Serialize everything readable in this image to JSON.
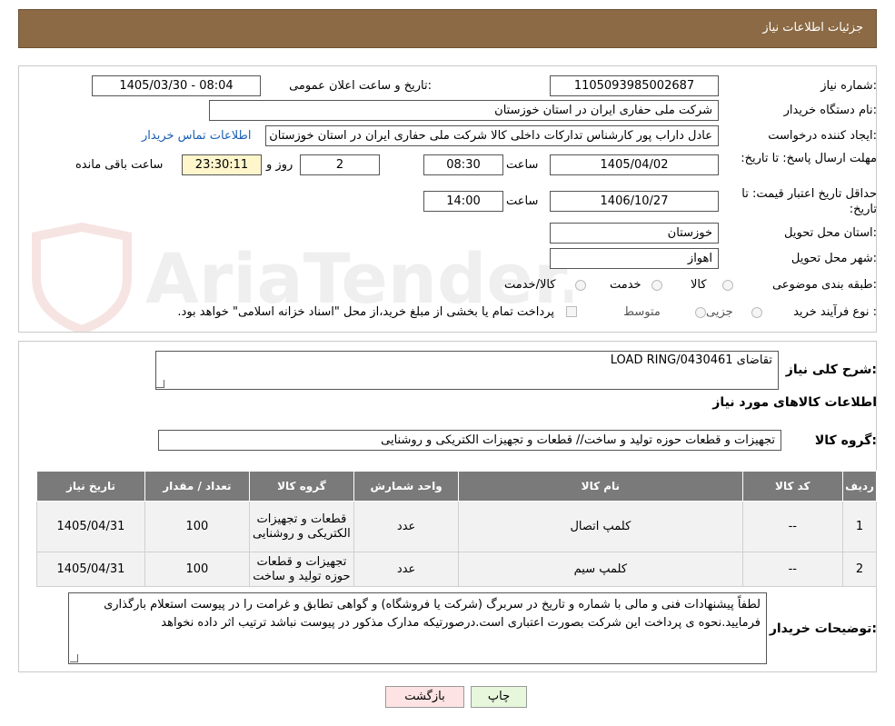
{
  "header": {
    "title": "جزئیات اطلاعات نیاز"
  },
  "labels": {
    "need_number": "شماره نیاز:",
    "announce_datetime": "تاریخ و ساعت اعلان عمومی:",
    "buyer_org": "نام دستگاه خریدار:",
    "requester": "ایجاد کننده درخواست:",
    "reply_deadline": "مهلت ارسال پاسخ: تا تاریخ:",
    "price_validity": "حداقل تاریخ اعتبار قیمت: تا تاریخ:",
    "time": "ساعت",
    "day_and": "روز و",
    "remaining": "ساعت باقی مانده",
    "province": "استان محل تحویل:",
    "city": "شهر محل تحویل:",
    "category": "طبقه بندی موضوعی:",
    "process_type": "نوع فرآیند خرید :",
    "summary": "شرح کلی نیاز:",
    "goods_info": "اطلاعات کالاهای مورد نیاز",
    "goods_group": "گروه کالا:",
    "buyer_notes": "توضیحات خریدار:"
  },
  "values": {
    "need_number": "1105093985002687",
    "announce_datetime": "1405/03/30 - 08:04",
    "buyer_org": "شرکت ملی حفاری ایران در استان خوزستان",
    "requester": "عادل داراب پور کارشناس تدارکات داخلی کالا شرکت ملی حفاری ایران در استان خوزستان",
    "contact_link": "اطلاعات تماس خریدار",
    "reply_date": "1405/04/02",
    "reply_time": "08:30",
    "days": "2",
    "remaining_time": "23:30:11",
    "validity_date": "1406/10/27",
    "validity_time": "14:00",
    "province": "خوزستان",
    "city": "اهواز",
    "summary": "تقاضای LOAD RING/0430461",
    "goods_group": "تجهیزات و قطعات حوزه تولید و ساخت// قطعات و تجهیزات الکتریکی و روشنایی",
    "buyer_notes": "لطفاً پیشنهادات فنی و مالی با شماره و تاریخ در سربرگ (شرکت یا فروشگاه) و گواهی تطابق و غرامت را در پیوست استعلام بارگذاری فرمایید.نحوه ی پرداخت این شرکت بصورت اعتباری است.درصورتیکه مدارک مذکور در پیوست نباشد ترتیب اثر داده نخواهد"
  },
  "category_options": [
    "کالا",
    "خدمت",
    "کالا/خدمت"
  ],
  "process_options": [
    "جزیی",
    "متوسط"
  ],
  "payment_note": "پرداخت تمام یا بخشی از مبلغ خرید،از محل \"اسناد خزانه اسلامی\" خواهد بود.",
  "table": {
    "headers": [
      "ردیف",
      "کد کالا",
      "نام کالا",
      "واحد شمارش",
      "گروه کالا",
      "تعداد / مقدار",
      "تاریخ نیاز"
    ],
    "rows": [
      [
        "1",
        "--",
        "کلمپ اتصال",
        "عدد",
        "قطعات و تجهیزات الکتریکی و روشنایی",
        "100",
        "1405/04/31"
      ],
      [
        "2",
        "--",
        "کلمپ سیم",
        "عدد",
        "تجهیزات و قطعات حوزه تولید و ساخت",
        "100",
        "1405/04/31"
      ]
    ]
  },
  "buttons": {
    "print": "چاپ",
    "back": "بازگشت"
  },
  "watermark": {
    "text": "AriaTender.neT"
  },
  "colors": {
    "header": "#8b6a45",
    "table_header": "#7a7a7a",
    "link": "#1a5fb4",
    "back_button": "#fde3e3",
    "print_button": "#e6f7dc"
  }
}
